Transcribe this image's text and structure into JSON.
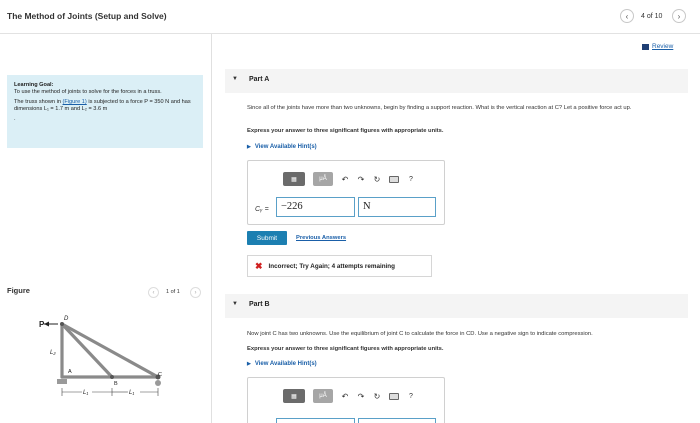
{
  "header": {
    "title": "The Method of Joints (Setup and Solve)",
    "pager": "4 of 10",
    "prev_glyph": "‹",
    "next_glyph": "›",
    "review_label": "Review"
  },
  "learning_goal": {
    "title": "Learning Goal:",
    "text": "To use the method of joints to solve for the forces in a truss.",
    "problem_pre": "The truss shown in ",
    "figure_link": "(Figure 1)",
    "problem_post": " is subjected to a force P = 350 N and has dimensions L₁ = 1.7 m and L₂ = 3.6 m",
    "trailing": "."
  },
  "figure": {
    "label": "Figure",
    "pager": "1 of 1",
    "labels": {
      "P": "P",
      "D": "D",
      "L2": "L₂",
      "A": "A",
      "B": "B",
      "C": "C",
      "L1a": "L₁",
      "L1b": "L₁"
    }
  },
  "partA": {
    "title": "Part A",
    "question": "Since all of the joints have more than two unknowns, begin by finding a support reaction. What is the vertical reaction at C? Let a positive force act up.",
    "instruction": "Express your answer to three significant figures with appropriate units.",
    "hint_label": "View Available Hint(s)",
    "answer_label": "Cᵧ =",
    "answer_value": "−226",
    "unit_value": "N",
    "submit_label": "Submit",
    "previous_answers_label": "Previous Answers",
    "feedback": "Incorrect; Try Again; 4 attempts remaining"
  },
  "partB": {
    "title": "Part B",
    "question": "Now joint C has two unknowns. Use the equilibrium of joint C to calculate the force in CD. Use a negative sign to indicate compression.",
    "instruction": "Express your answer to three significant figures with appropriate units.",
    "hint_label": "View Available Hint(s)"
  },
  "toolbar": {
    "templates_glyph": "▦",
    "units_glyph": "μÅ",
    "undo_glyph": "↶",
    "redo_glyph": "↷",
    "reset_glyph": "↻",
    "help_glyph": "?"
  },
  "colors": {
    "accent": "#1c7fb1",
    "goal_bg": "#dbeff6",
    "error": "#d02020",
    "truss": "#8a8a8a"
  }
}
